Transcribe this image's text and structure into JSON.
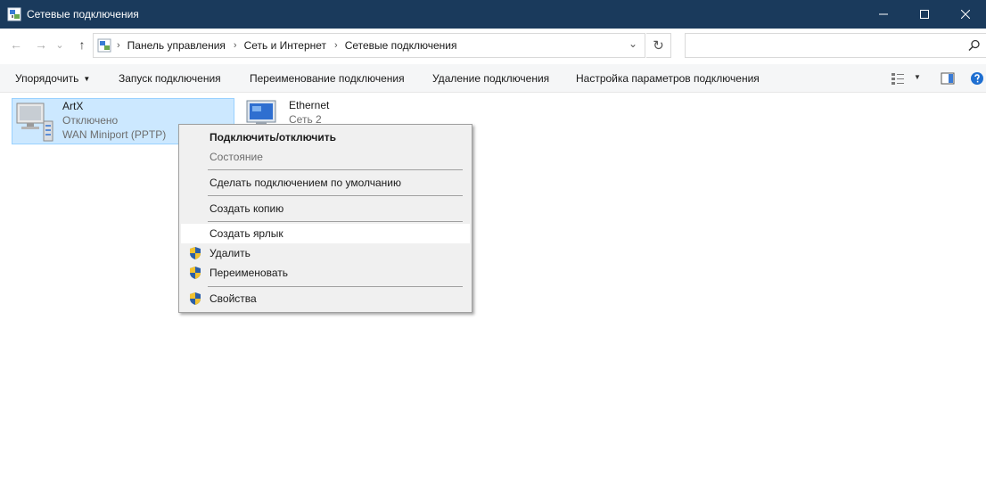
{
  "window": {
    "title": "Сетевые подключения",
    "minimize_glyph": "—",
    "maximize_glyph": "☐",
    "close_glyph": "✕"
  },
  "nav": {
    "back_glyph": "←",
    "forward_glyph": "→",
    "recent_glyph": "⌄",
    "up_glyph": "↑"
  },
  "breadcrumb": [
    "Панель управления",
    "Сеть и Интернет",
    "Сетевые подключения"
  ],
  "breadcrumb_separator": "›",
  "address_dropdown_glyph": "⌄",
  "refresh_glyph": "↻",
  "search": {
    "value": "",
    "placeholder": ""
  },
  "commands": {
    "organize": "Упорядочить",
    "start": "Запуск подключения",
    "rename": "Переименование подключения",
    "delete": "Удаление подключения",
    "settings": "Настройка параметров подключения",
    "dropdown_glyph": "▼"
  },
  "connections": [
    {
      "name": "ArtX",
      "status": "Отключено",
      "device": "WAN Miniport (PPTP)",
      "icon": "network-computer-icon",
      "selected": true
    },
    {
      "name": "Ethernet",
      "status": "Сеть 2",
      "icon": "network-adapter-icon",
      "selected": false
    }
  ],
  "context_menu": {
    "items": [
      {
        "label": "Подключить/отключить",
        "bold": true
      },
      {
        "label": "Состояние",
        "disabled": true
      },
      {
        "label": "Сделать подключением по умолчанию"
      },
      {
        "label": "Создать копию"
      },
      {
        "label": "Создать ярлык",
        "hover": true
      },
      {
        "label": "Удалить",
        "icon": "uac-shield-icon"
      },
      {
        "label": "Переименовать",
        "icon": "uac-shield-icon"
      },
      {
        "label": "Свойства",
        "icon": "uac-shield-icon"
      }
    ]
  },
  "colors": {
    "titlebar": "#1a3a5c",
    "selection": "#cce8ff",
    "selection_border": "#99d1ff",
    "menu_bg": "#f0f0f0"
  }
}
